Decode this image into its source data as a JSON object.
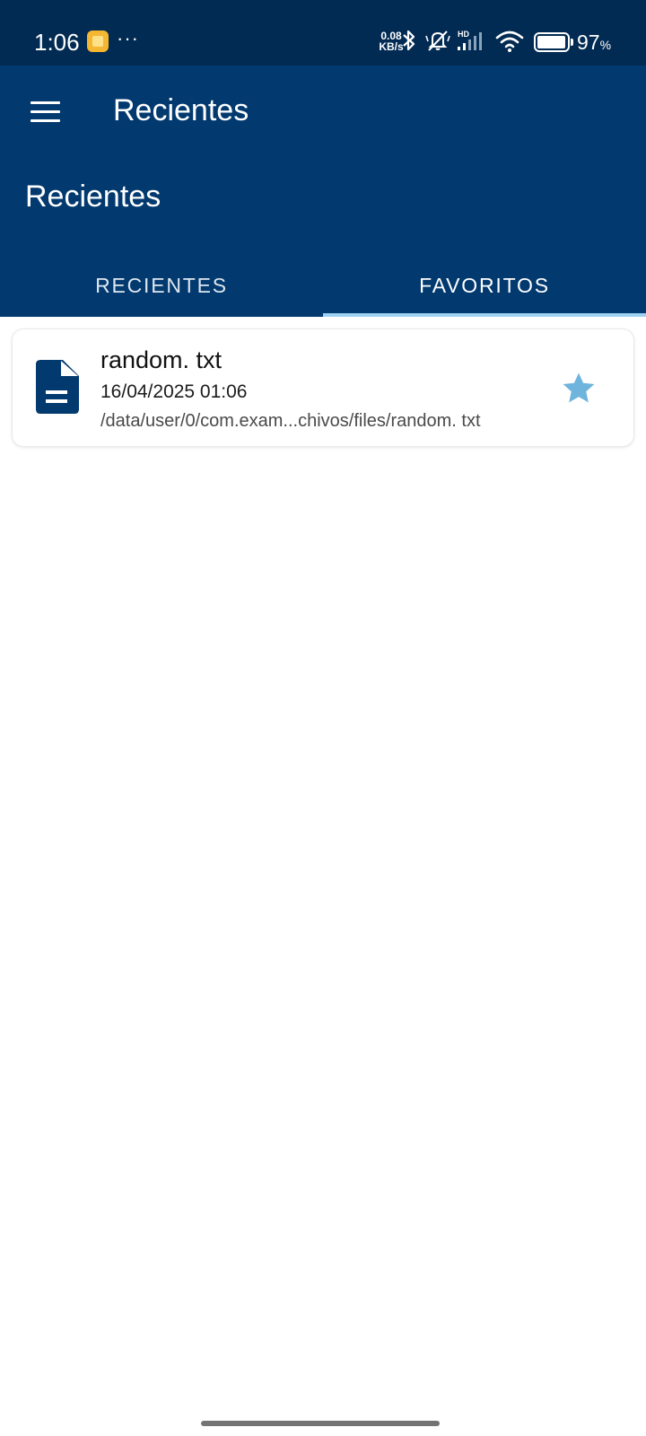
{
  "status_bar": {
    "time": "1:06",
    "network_speed_value": "0.08",
    "network_speed_unit": "KB/s",
    "hd_label": "HD",
    "battery_percent": "97",
    "battery_unit": "%",
    "icons": [
      "app-notification-icon",
      "more-dots-icon",
      "bluetooth-icon",
      "bell-off-icon",
      "signal-icon",
      "wifi-icon",
      "battery-icon"
    ]
  },
  "app_bar": {
    "toolbar_title": "Recientes",
    "section_title": "Recientes",
    "tabs": [
      {
        "label": "RECIENTES",
        "active": false
      },
      {
        "label": "FAVORITOS",
        "active": true
      }
    ]
  },
  "files": [
    {
      "name": "random. txt",
      "date": "16/04/2025 01:06",
      "path": "/data/user/0/com.exam...chivos/files/random. txt",
      "favorite": true,
      "icon": "document-icon"
    }
  ],
  "colors": {
    "status_bar": "#022b53",
    "app_bar": "#02396f",
    "tab_indicator": "#9dd2f2",
    "file_icon": "#02396f",
    "star": "#6fb4dd"
  }
}
